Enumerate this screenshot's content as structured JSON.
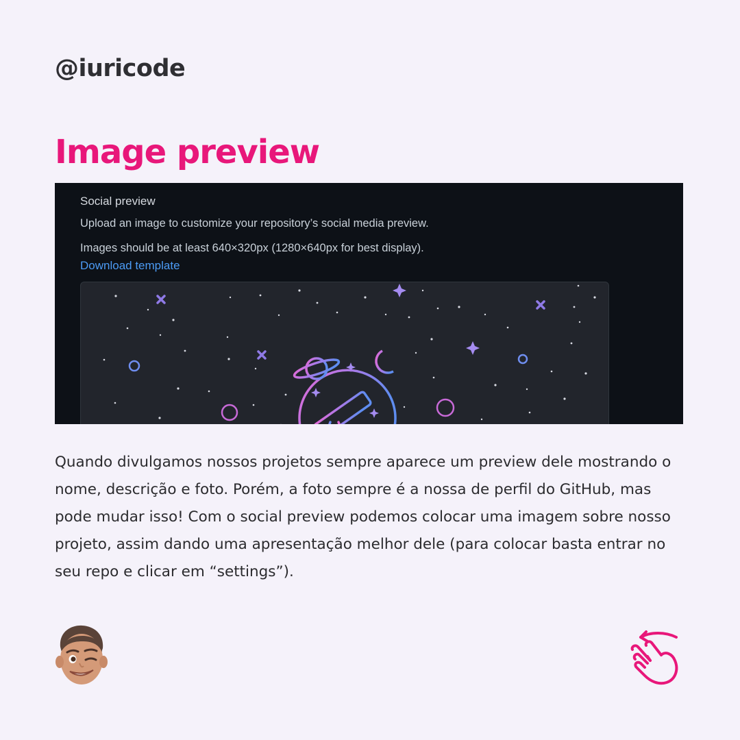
{
  "header": {
    "handle": "@iuricode"
  },
  "title": "Image preview",
  "screenshot": {
    "heading": "Social preview",
    "line1": "Upload an image to customize your repository’s social media preview.",
    "line2": "Images should be at least 640×320px (1280×640px for best display).",
    "link_label": "Download template",
    "illustration_icon": "space-telescope-illustration"
  },
  "body_text": "Quando divulgamos nossos projetos sempre aparece um preview dele mostrando o nome, descrição e foto. Porém, a foto sempre é a nossa de perfil do GitHub, mas pode mudar isso! Com o social preview podemos colocar uma imagem sobre nosso projeto, assim dando uma apresentação melhor dele (para colocar basta entrar no seu repo e clicar em “settings”).",
  "footer": {
    "avatar_icon": "memoji-winking-avatar",
    "swipe_icon": "swipe-hand-icon"
  },
  "colors": {
    "background": "#f5f2fa",
    "accent": "#e8177a",
    "text": "#2b2b2e",
    "screenshot_bg": "#0d1117",
    "link": "#4c9bf5"
  }
}
